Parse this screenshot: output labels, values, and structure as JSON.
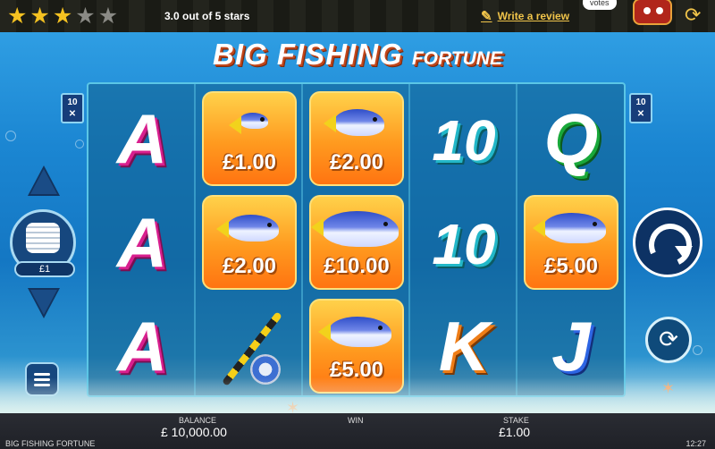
{
  "rating": {
    "value": 3,
    "max": 5,
    "text": "3.0 out of 5 stars"
  },
  "review": {
    "link": "Write a review",
    "votes": "votes"
  },
  "game": {
    "logo_main": "BIG FISHING ",
    "logo_small": "FORTUNE",
    "name": "BIG FISHING FORTUNE",
    "ways_top": "10",
    "ways_bottom": "✕"
  },
  "reels": {
    "r1": [
      "A",
      "A",
      "A"
    ],
    "r2": [
      "£1.00",
      "£2.00",
      "rod"
    ],
    "r3": [
      "£2.00",
      "£10.00",
      "£5.00"
    ],
    "r4": [
      "10",
      "10",
      "K"
    ],
    "r5": [
      "Q",
      "£5.00",
      "J"
    ]
  },
  "controls": {
    "coin_value": "£1",
    "spin": "spin-icon",
    "autoplay": "autoplay-icon",
    "menu": "menu-icon"
  },
  "footer": {
    "balance_label": "BALANCE",
    "balance": "£ 10,000.00",
    "win_label": "WIN",
    "stake_label": "STAKE",
    "stake": "£1.00",
    "time": "12:27"
  },
  "colors": {
    "star_on": "#f5c221",
    "star_off": "#8a8a85",
    "link": "#f0c44a",
    "reel_border": "#5bc6e6"
  }
}
